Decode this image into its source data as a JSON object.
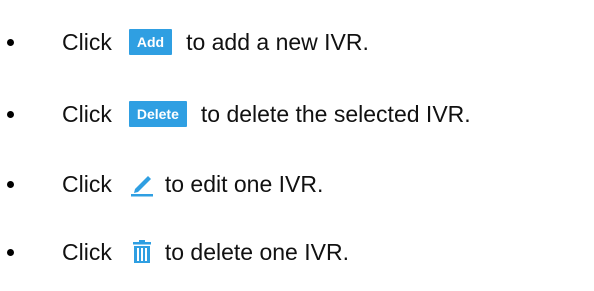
{
  "items": [
    {
      "click": "Click",
      "button_label": "Add",
      "text": "to add a new IVR."
    },
    {
      "click": "Click",
      "button_label": "Delete",
      "text": "to delete the selected IVR."
    },
    {
      "click": "Click",
      "icon": "pencil-edit-icon",
      "text": "to edit one IVR."
    },
    {
      "click": "Click",
      "icon": "trash-icon",
      "text": "to delete one IVR."
    }
  ],
  "colors": {
    "accent": "#2f9fe2",
    "text": "#111111"
  }
}
